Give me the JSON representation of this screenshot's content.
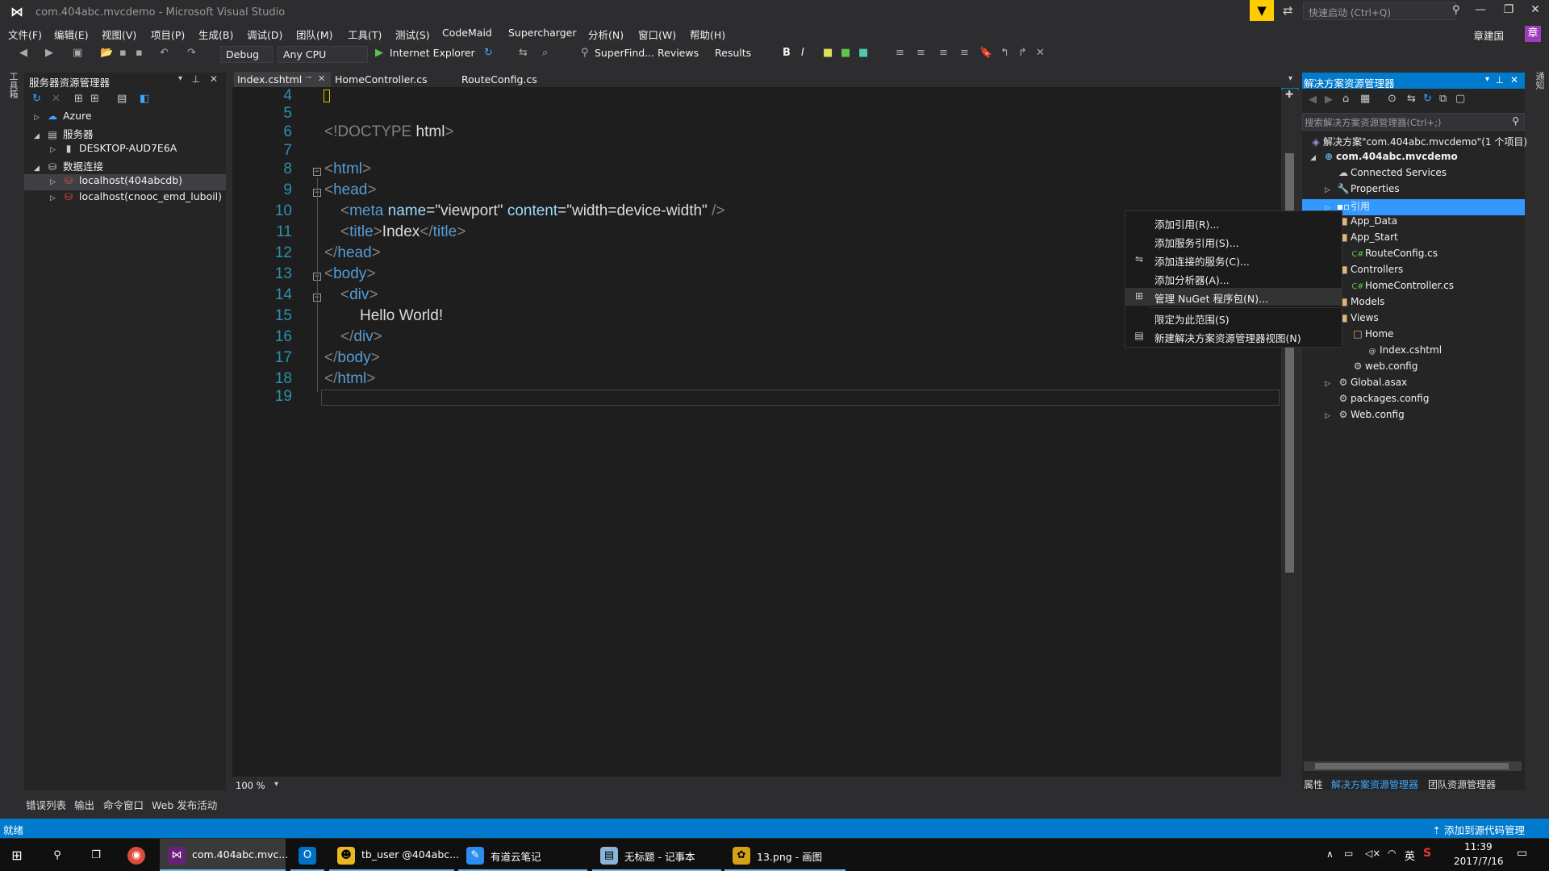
{
  "window": {
    "title": "com.404abc.mvcdemo - Microsoft Visual Studio",
    "quick_launch_placeholder": "快速启动 (Ctrl+Q)"
  },
  "menu": [
    "文件(F)",
    "编辑(E)",
    "视图(V)",
    "项目(P)",
    "生成(B)",
    "调试(D)",
    "团队(M)",
    "工具(T)",
    "测试(S)",
    "CodeMaid",
    "Supercharger",
    "分析(N)",
    "窗口(W)",
    "帮助(H)"
  ],
  "user": {
    "name": "章建国",
    "initial": "章"
  },
  "toolbar": {
    "config": "Debug",
    "platform": "Any CPU",
    "run_target": "Internet Explorer",
    "superfind": "SuperFind...",
    "reviews": "Reviews",
    "results": "Results",
    "bold": "B",
    "italic": "I"
  },
  "left_strip_label": "工具箱",
  "right_strip_label": "通知",
  "server_explorer": {
    "title": "服务器资源管理器",
    "items": [
      {
        "label": "Azure",
        "icon": "cloud-icon"
      },
      {
        "label": "服务器",
        "icon": "server-icon"
      },
      {
        "label": "DESKTOP-AUD7E6A",
        "icon": "computer-icon"
      },
      {
        "label": "数据连接",
        "icon": "data-connections-icon"
      },
      {
        "label": "localhost(404abcdb)",
        "icon": "database-error-icon"
      },
      {
        "label": "localhost(cnooc_emd_luboil)",
        "icon": "database-error-icon"
      }
    ]
  },
  "editor": {
    "tabs": [
      "Index.cshtml",
      "HomeController.cs",
      "RouteConfig.cs"
    ],
    "zoom": "100 %",
    "line_numbers": [
      "4",
      "5",
      "6",
      "7",
      "8",
      "9",
      "10",
      "11",
      "12",
      "13",
      "14",
      "15",
      "16",
      "17",
      "18",
      "19"
    ],
    "code": {
      "doctype_open": "<!DOCTYPE",
      "doctype_word": "html",
      "lt": "<",
      "gt": ">",
      "lt_slash": "</",
      "self_close": " />",
      "html": "html",
      "head": "head",
      "meta": "meta",
      "name_attr": "name",
      "name_val": "\"viewport\"",
      "content_attr": "content",
      "content_val": "\"width=device-width\"",
      "eq": "=",
      "title": "title",
      "title_text": "Index",
      "body": "body",
      "div": "div",
      "hello": "Hello World!"
    }
  },
  "bottom_tabs": [
    "错误列表",
    "输出",
    "命令窗口",
    "Web 发布活动"
  ],
  "solution_explorer": {
    "title": "解决方案资源管理器",
    "search_placeholder": "搜索解决方案资源管理器(Ctrl+;)",
    "items": [
      {
        "label": "解决方案\"com.404abc.mvcdemo\"(1 个项目)",
        "icon": "solution-icon"
      },
      {
        "label": "com.404abc.mvcdemo",
        "icon": "web-project-icon"
      },
      {
        "label": "Connected Services",
        "icon": "connected-services-icon"
      },
      {
        "label": "Properties",
        "icon": "wrench-icon"
      },
      {
        "label": "引用",
        "icon": "references-icon"
      },
      {
        "label": "App_Data",
        "icon": "folder-icon"
      },
      {
        "label": "App_Start",
        "icon": "folder-icon"
      },
      {
        "label": "RouteConfig.cs",
        "icon": "csharp-file-icon"
      },
      {
        "label": "Controllers",
        "icon": "folder-icon"
      },
      {
        "label": "HomeController.cs",
        "icon": "csharp-file-icon"
      },
      {
        "label": "Models",
        "icon": "folder-icon"
      },
      {
        "label": "Views",
        "icon": "folder-icon"
      },
      {
        "label": "Home",
        "icon": "folder-open-icon"
      },
      {
        "label": "Index.cshtml",
        "icon": "razor-file-icon"
      },
      {
        "label": "web.config",
        "icon": "config-file-icon"
      },
      {
        "label": "Global.asax",
        "icon": "config-file-icon"
      },
      {
        "label": "packages.config",
        "icon": "config-file-icon"
      },
      {
        "label": "Web.config",
        "icon": "config-file-icon"
      }
    ],
    "footer_tabs": [
      "属性",
      "解决方案资源管理器",
      "团队资源管理器"
    ]
  },
  "context_menu": {
    "items": [
      {
        "label": "添加引用(R)..."
      },
      {
        "label": "添加服务引用(S)..."
      },
      {
        "label": "添加连接的服务(C)..."
      },
      {
        "label": "添加分析器(A)..."
      },
      {
        "label": "管理 NuGet 程序包(N)..."
      },
      {
        "label": "限定为此范围(S)"
      },
      {
        "label": "新建解决方案资源管理器视图(N)"
      }
    ]
  },
  "status": {
    "left": "就绪",
    "right": "添加到源代码管理"
  },
  "taskbar": {
    "tasks": [
      {
        "label": "com.404abc.mvc..."
      },
      {
        "label": "tb_user @404abc..."
      },
      {
        "label": "有道云笔记"
      },
      {
        "label": "无标题 - 记事本"
      },
      {
        "label": "13.png - 画图"
      }
    ],
    "ime": "英",
    "time": "11:39",
    "date": "2017/7/16"
  },
  "colors": {
    "accent": "#007acc",
    "selection": "#3399ff",
    "editor_bg": "#1e1e1e",
    "tag_blue": "#569cd6",
    "line_number": "#2b91af"
  }
}
